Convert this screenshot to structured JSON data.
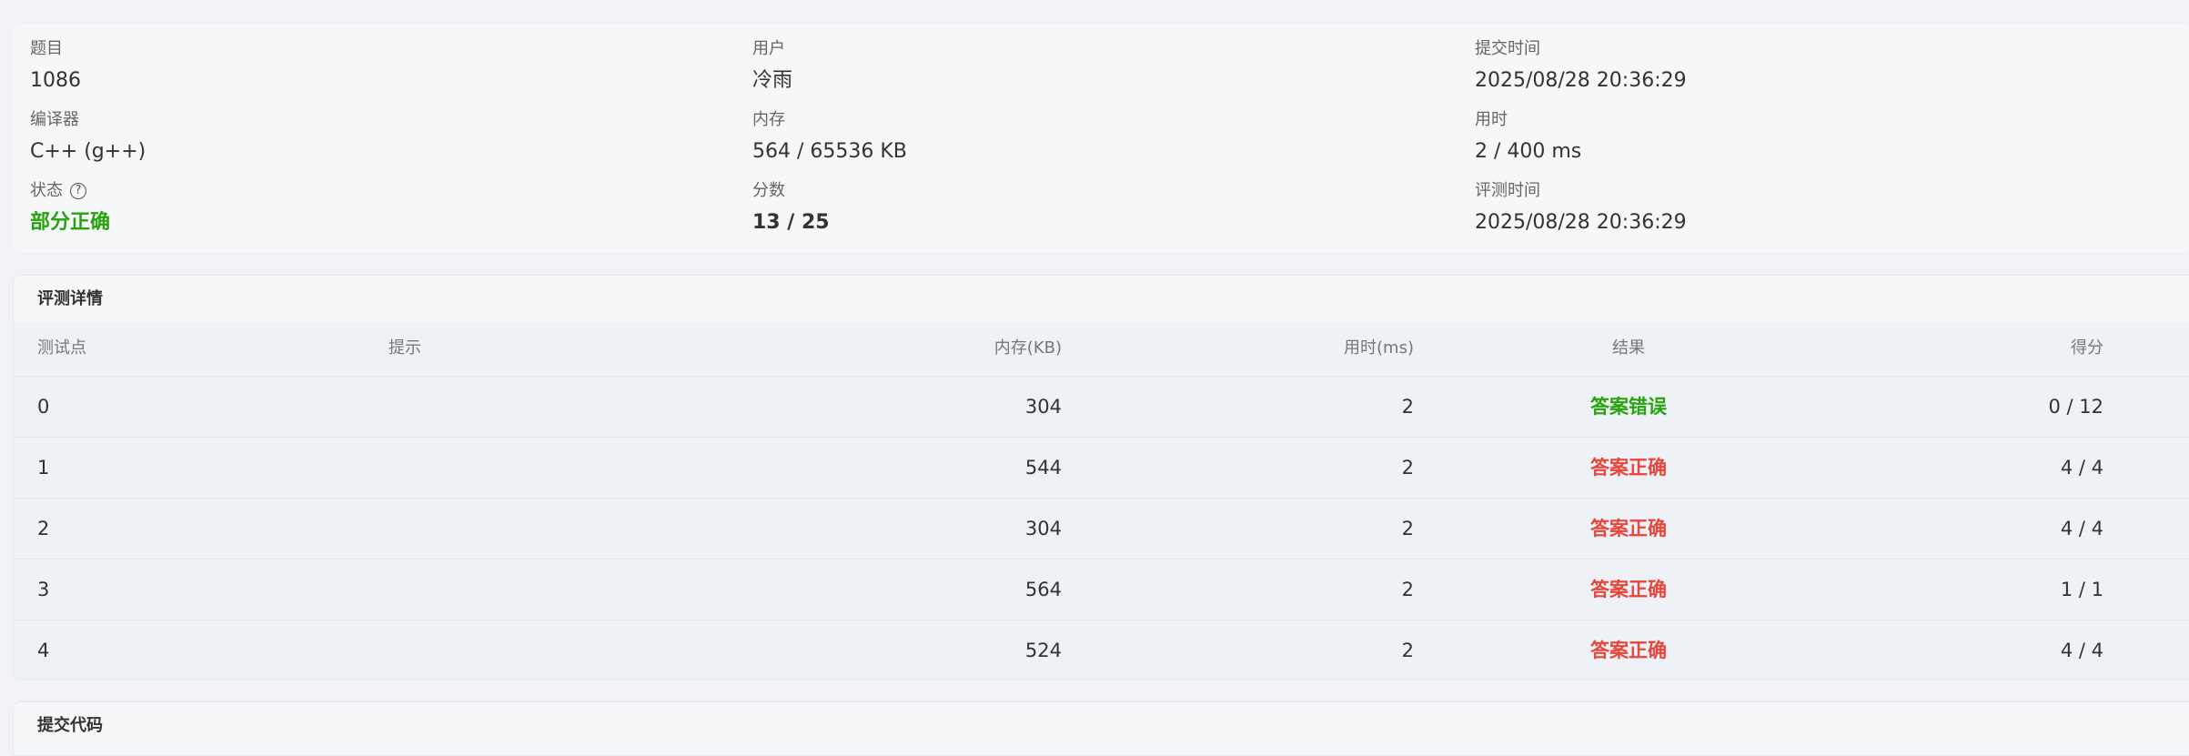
{
  "summary": {
    "problem": {
      "label": "题目",
      "value": "1086"
    },
    "user": {
      "label": "用户",
      "value": "冷雨"
    },
    "submit_time": {
      "label": "提交时间",
      "value": "2025/08/28 20:36:29"
    },
    "compiler": {
      "label": "编译器",
      "value": "C++ (g++)"
    },
    "memory": {
      "label": "内存",
      "value": "564 / 65536 KB"
    },
    "time_used": {
      "label": "用时",
      "value": "2 / 400 ms"
    },
    "status": {
      "label": "状态",
      "value": "部分正确",
      "help_icon": "?"
    },
    "score": {
      "label": "分数",
      "value": "13 / 25"
    },
    "judge_time": {
      "label": "评测时间",
      "value": "2025/08/28 20:36:29"
    }
  },
  "details": {
    "title": "评测详情",
    "columns": {
      "test": "测试点",
      "hint": "提示",
      "memory": "内存(KB)",
      "time": "用时(ms)",
      "result": "结果",
      "score": "得分"
    },
    "rows": [
      {
        "test": "0",
        "hint": "",
        "memory": "304",
        "time": "2",
        "result": "答案错误",
        "score": "0 / 12"
      },
      {
        "test": "1",
        "hint": "",
        "memory": "544",
        "time": "2",
        "result": "答案正确",
        "score": "4 / 4"
      },
      {
        "test": "2",
        "hint": "",
        "memory": "304",
        "time": "2",
        "result": "答案正确",
        "score": "4 / 4"
      },
      {
        "test": "3",
        "hint": "",
        "memory": "564",
        "time": "2",
        "result": "答案正确",
        "score": "1 / 1"
      },
      {
        "test": "4",
        "hint": "",
        "memory": "524",
        "time": "2",
        "result": "答案正确",
        "score": "4 / 4"
      }
    ]
  },
  "code": {
    "title": "提交代码"
  },
  "colors": {
    "partial": "#27a30e",
    "wrong_answer": "#27a30e",
    "accepted": "#e8453c"
  }
}
